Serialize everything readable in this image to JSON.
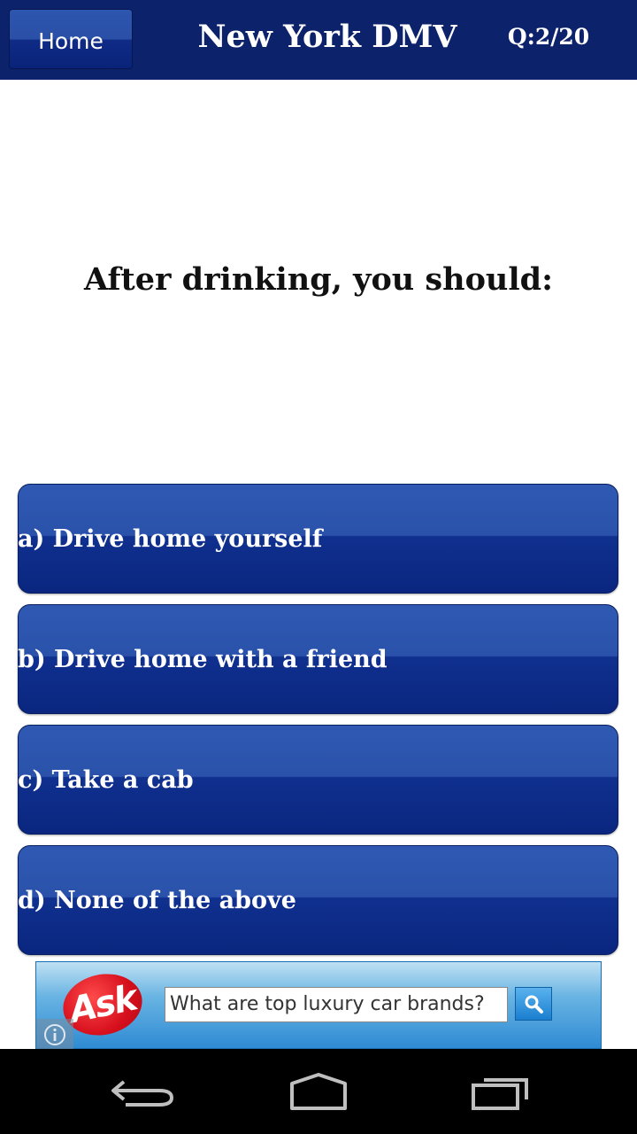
{
  "header": {
    "home_label": "Home",
    "title": "New York DMV",
    "counter": "Q:2/20"
  },
  "question": {
    "text": "After drinking, you should:"
  },
  "answers": [
    {
      "label": "a) Drive home yourself"
    },
    {
      "label": "b) Drive home with a friend"
    },
    {
      "label": "c) Take a cab"
    },
    {
      "label": "d) None of the above"
    }
  ],
  "ad": {
    "logo_text": "Ask",
    "search_text": "What are top luxury car brands?",
    "icons": [
      "search-icon",
      "info-icon"
    ]
  },
  "navbar": {
    "icons": [
      "back-icon",
      "home-icon",
      "recent-apps-icon"
    ]
  },
  "colors": {
    "header_bg": "#0c226b",
    "button_blue": "#0a267f",
    "ask_red": "#d60f1d"
  }
}
